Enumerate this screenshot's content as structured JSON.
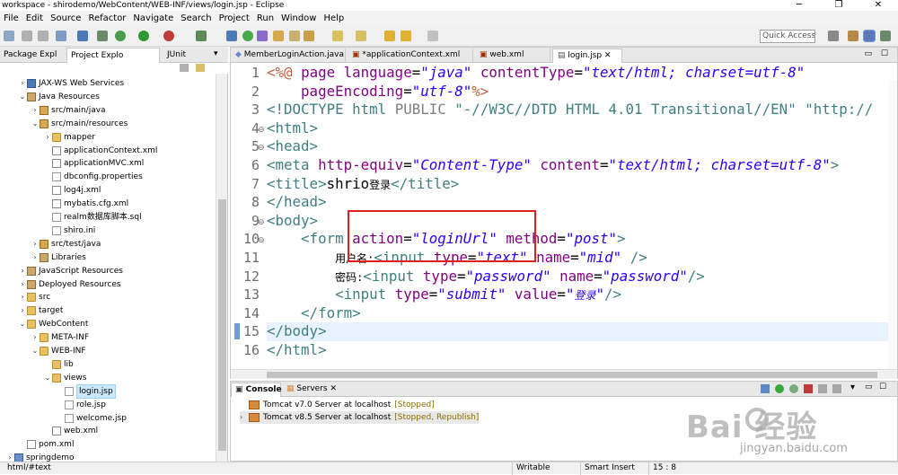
{
  "window": {
    "title": "workspace - shirodemo/WebContent/WEB-INF/views/login.jsp - Eclipse",
    "controls": [
      "─",
      "❐",
      "✕"
    ]
  },
  "menubar": [
    "File",
    "Edit",
    "Source",
    "Refactor",
    "Navigate",
    "Search",
    "Project",
    "Run",
    "Window",
    "Help"
  ],
  "toolbar": {
    "quick_access_placeholder": "Quick Access"
  },
  "left_panel": {
    "tabs": [
      {
        "label": "Package Expl",
        "active": false
      },
      {
        "label": "Project Explo",
        "active": true
      },
      {
        "label": "JUnit",
        "active": false
      }
    ],
    "tree": [
      {
        "label": "JAX-WS Web Services",
        "depth": 1,
        "twisty": "›",
        "icon": "ws"
      },
      {
        "label": "Java Resources",
        "depth": 1,
        "twisty": "⌄",
        "icon": "lib"
      },
      {
        "label": "src/main/java",
        "depth": 2,
        "twisty": "›",
        "icon": "pkg"
      },
      {
        "label": "src/main/resources",
        "depth": 2,
        "twisty": "⌄",
        "icon": "pkg"
      },
      {
        "label": "mapper",
        "depth": 3,
        "twisty": "›",
        "icon": "folder"
      },
      {
        "label": "applicationContext.xml",
        "depth": 3,
        "twisty": "",
        "icon": "xml"
      },
      {
        "label": "applicationMVC.xml",
        "depth": 3,
        "twisty": "",
        "icon": "xml"
      },
      {
        "label": "dbconfig.properties",
        "depth": 3,
        "twisty": "",
        "icon": "file"
      },
      {
        "label": "log4j.xml",
        "depth": 3,
        "twisty": "",
        "icon": "xml"
      },
      {
        "label": "mybatis.cfg.xml",
        "depth": 3,
        "twisty": "",
        "icon": "xml"
      },
      {
        "label": "realm数据库脚本.sql",
        "depth": 3,
        "twisty": "",
        "icon": "file"
      },
      {
        "label": "shiro.ini",
        "depth": 3,
        "twisty": "",
        "icon": "file"
      },
      {
        "label": "src/test/java",
        "depth": 2,
        "twisty": "›",
        "icon": "pkg"
      },
      {
        "label": "Libraries",
        "depth": 2,
        "twisty": "›",
        "icon": "lib"
      },
      {
        "label": "JavaScript Resources",
        "depth": 1,
        "twisty": "›",
        "icon": "lib"
      },
      {
        "label": "Deployed Resources",
        "depth": 1,
        "twisty": "›",
        "icon": "lib"
      },
      {
        "label": "src",
        "depth": 1,
        "twisty": "›",
        "icon": "folder"
      },
      {
        "label": "target",
        "depth": 1,
        "twisty": "›",
        "icon": "folder"
      },
      {
        "label": "WebContent",
        "depth": 1,
        "twisty": "⌄",
        "icon": "folder"
      },
      {
        "label": "META-INF",
        "depth": 2,
        "twisty": "›",
        "icon": "folder"
      },
      {
        "label": "WEB-INF",
        "depth": 2,
        "twisty": "⌄",
        "icon": "folder"
      },
      {
        "label": "lib",
        "depth": 3,
        "twisty": "",
        "icon": "folder"
      },
      {
        "label": "views",
        "depth": 3,
        "twisty": "⌄",
        "icon": "folder"
      },
      {
        "label": "login.jsp",
        "depth": 4,
        "twisty": "",
        "icon": "file",
        "selected": true
      },
      {
        "label": "role.jsp",
        "depth": 4,
        "twisty": "",
        "icon": "file"
      },
      {
        "label": "welcome.jsp",
        "depth": 4,
        "twisty": "",
        "icon": "file"
      },
      {
        "label": "web.xml",
        "depth": 3,
        "twisty": "",
        "icon": "xml"
      },
      {
        "label": "pom.xml",
        "depth": 1,
        "twisty": "",
        "icon": "xml"
      },
      {
        "label": "springdemo",
        "depth": 0,
        "twisty": "›",
        "icon": "proj"
      }
    ]
  },
  "editor": {
    "tabs": [
      {
        "label": "MemberLoginAction.java",
        "active": false
      },
      {
        "label": "*applicationContext.xml",
        "active": false
      },
      {
        "label": "web.xml",
        "active": false
      },
      {
        "label": "login.jsp",
        "active": true
      }
    ],
    "current_line": 15,
    "lines": [
      {
        "n": "1",
        "fold": ""
      },
      {
        "n": "2",
        "fold": ""
      },
      {
        "n": "3",
        "fold": ""
      },
      {
        "n": "4",
        "fold": "⊖"
      },
      {
        "n": "5",
        "fold": "⊖"
      },
      {
        "n": "6",
        "fold": ""
      },
      {
        "n": "7",
        "fold": ""
      },
      {
        "n": "8",
        "fold": ""
      },
      {
        "n": "9",
        "fold": "⊖"
      },
      {
        "n": "10",
        "fold": "⊖"
      },
      {
        "n": "11",
        "fold": ""
      },
      {
        "n": "12",
        "fold": ""
      },
      {
        "n": "13",
        "fold": ""
      },
      {
        "n": "14",
        "fold": ""
      },
      {
        "n": "15",
        "fold": ""
      },
      {
        "n": "16",
        "fold": ""
      }
    ]
  },
  "bottom_panel": {
    "tabs": [
      {
        "label": "Console",
        "active": true
      },
      {
        "label": "Servers",
        "active": false
      }
    ],
    "servers": [
      {
        "name": "Tomcat v7.0 Server at localhost",
        "status": "[Stopped]"
      },
      {
        "name": "Tomcat v8.5 Server at localhost",
        "status": "[Stopped, Republish]"
      }
    ]
  },
  "statusbar": {
    "path": "html/#text",
    "mode": "Writable",
    "insert": "Smart Insert",
    "position": "15 : 8"
  },
  "watermark": {
    "brand": "Bai  经验",
    "url": "jingyan.baidu.com"
  },
  "colors": {
    "tag": "#3f7f7f",
    "attribute": "#7f007f",
    "string": "#2a00ff",
    "highlight_box": "#e0201c"
  }
}
